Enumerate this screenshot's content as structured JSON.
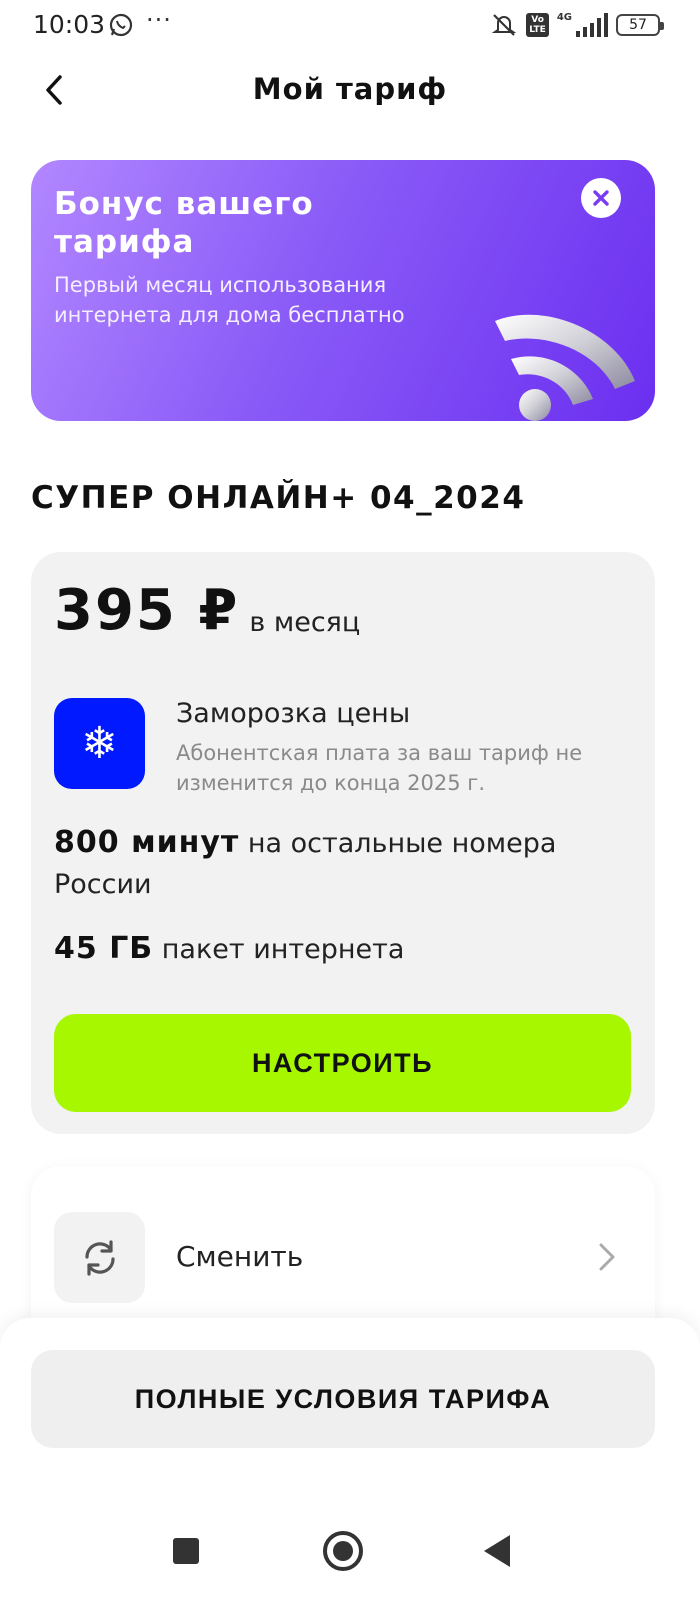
{
  "status_bar": {
    "time": "10:03",
    "volte": "Vo\nLTE",
    "network": "4G",
    "battery": "57",
    "icons": [
      "whatsapp-icon",
      "more-dots-icon",
      "muted-icon",
      "volte-icon",
      "signal-icon",
      "battery-icon"
    ]
  },
  "header": {
    "title": "Мой тариф",
    "back_icon": "chevron-left-icon"
  },
  "bonus": {
    "title": "Бонус вашего тарифа",
    "text": "Первый месяц использования интернета для дома бесплатно",
    "close_icon": "close-icon",
    "image_icon": "wifi-icon"
  },
  "tariff": {
    "name": "СУПЕР ОНЛАЙН+ 04_2024",
    "price": "395 ₽",
    "period": "в месяц",
    "freeze": {
      "icon": "snowflake-icon",
      "title": "Заморозка цены",
      "text": "Абонентская плата за ваш тариф не изменится до конца 2025 г."
    },
    "minutes": {
      "value": "800 минут",
      "text": "на остальные номера России"
    },
    "internet": {
      "value": "45 ГБ",
      "text": "пакет интернета"
    },
    "configure_label": "НАСТРОИТЬ"
  },
  "change": {
    "label": "Сменить",
    "icon": "refresh-icon",
    "chevron": "chevron-right-icon"
  },
  "terms_label": "ПОЛНЫЕ УСЛОВИЯ ТАРИФА",
  "nav": {
    "icons": [
      "recent-apps-icon",
      "home-icon",
      "back-icon"
    ]
  },
  "colors": {
    "banner_start": "#b287ff",
    "banner_end": "#6b2ff0",
    "freeze_blue": "#0019ff",
    "accent_green": "#a6f700",
    "card_bg": "#f2f2f2"
  }
}
